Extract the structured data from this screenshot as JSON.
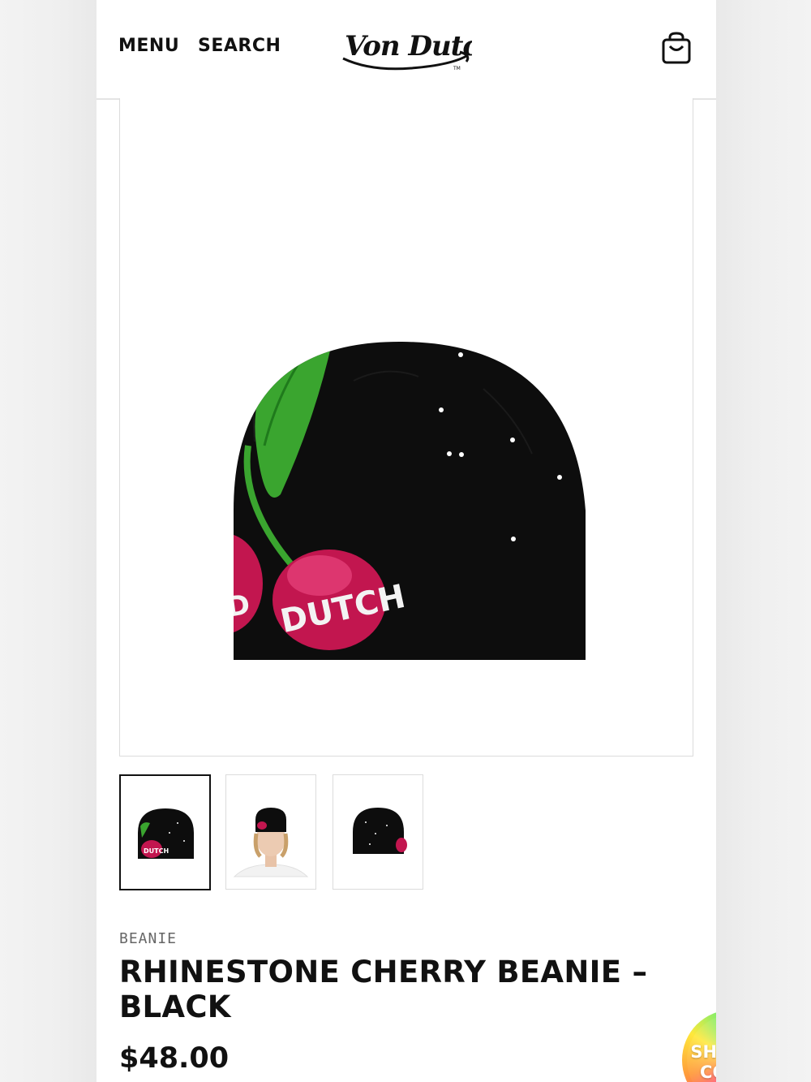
{
  "header": {
    "menu_label": "MENU",
    "search_label": "SEARCH",
    "logo_text": "Von Dutch",
    "cart_icon": "shopping-bag-icon"
  },
  "gallery": {
    "main_image_alt": "Rhinestone Cherry Beanie - Black",
    "thumbnails": [
      {
        "alt": "Beanie front view",
        "active": true
      },
      {
        "alt": "Model wearing beanie",
        "active": false
      },
      {
        "alt": "Beanie back view",
        "active": false
      }
    ]
  },
  "product": {
    "category": "BEANIE",
    "title": "RHINESTONE CHERRY BEANIE – BLACK",
    "price": "$48.00"
  },
  "shop_by_color": {
    "label": "SHOP BY COLOR"
  },
  "colors": {
    "text": "#111111",
    "beanie": "#0d0d0d",
    "cherry": "#c2164f",
    "leaf": "#3aa52f"
  }
}
